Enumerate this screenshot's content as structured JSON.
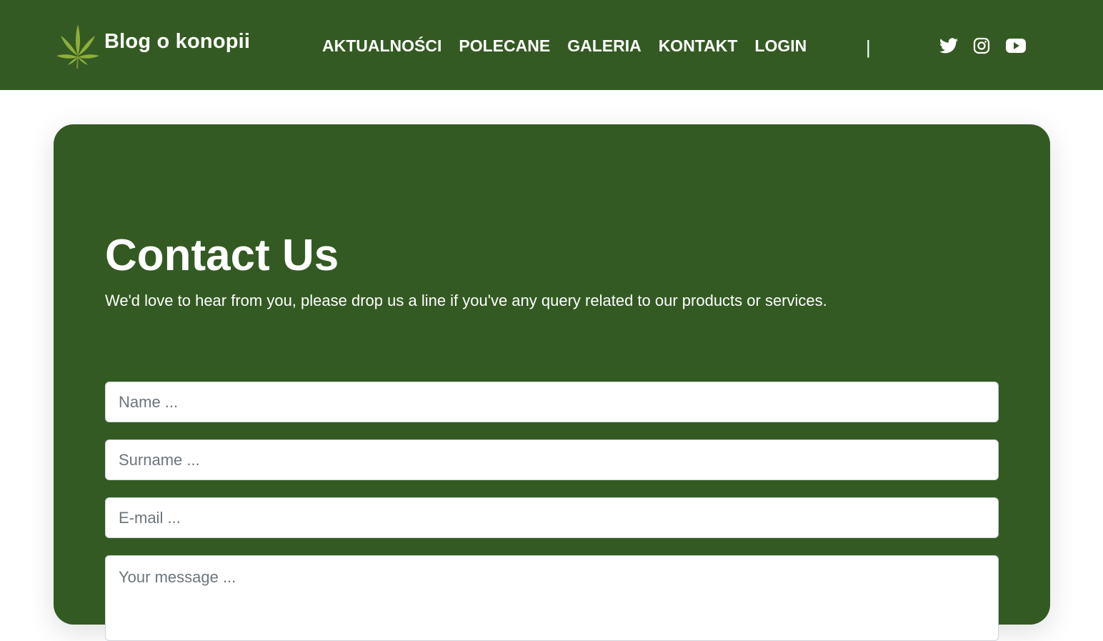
{
  "header": {
    "brand": "Blog o konopii",
    "nav": [
      "AKTUALNOŚCI",
      "POLECANE",
      "GALERIA",
      "KONTAKT",
      "LOGIN"
    ],
    "divider": "|",
    "social_icons": [
      "twitter-icon",
      "instagram-icon",
      "youtube-icon"
    ]
  },
  "contact": {
    "title": "Contact Us",
    "subtitle": "We'd love to hear from you, please drop us a line if you've any query related to our products or services.",
    "name_placeholder": "Name ...",
    "surname_placeholder": "Surname ...",
    "email_placeholder": "E-mail ...",
    "message_placeholder": "Your message ..."
  },
  "colors": {
    "brand_green": "#335a22",
    "text": "#ffffff",
    "placeholder": "#6c757d"
  }
}
